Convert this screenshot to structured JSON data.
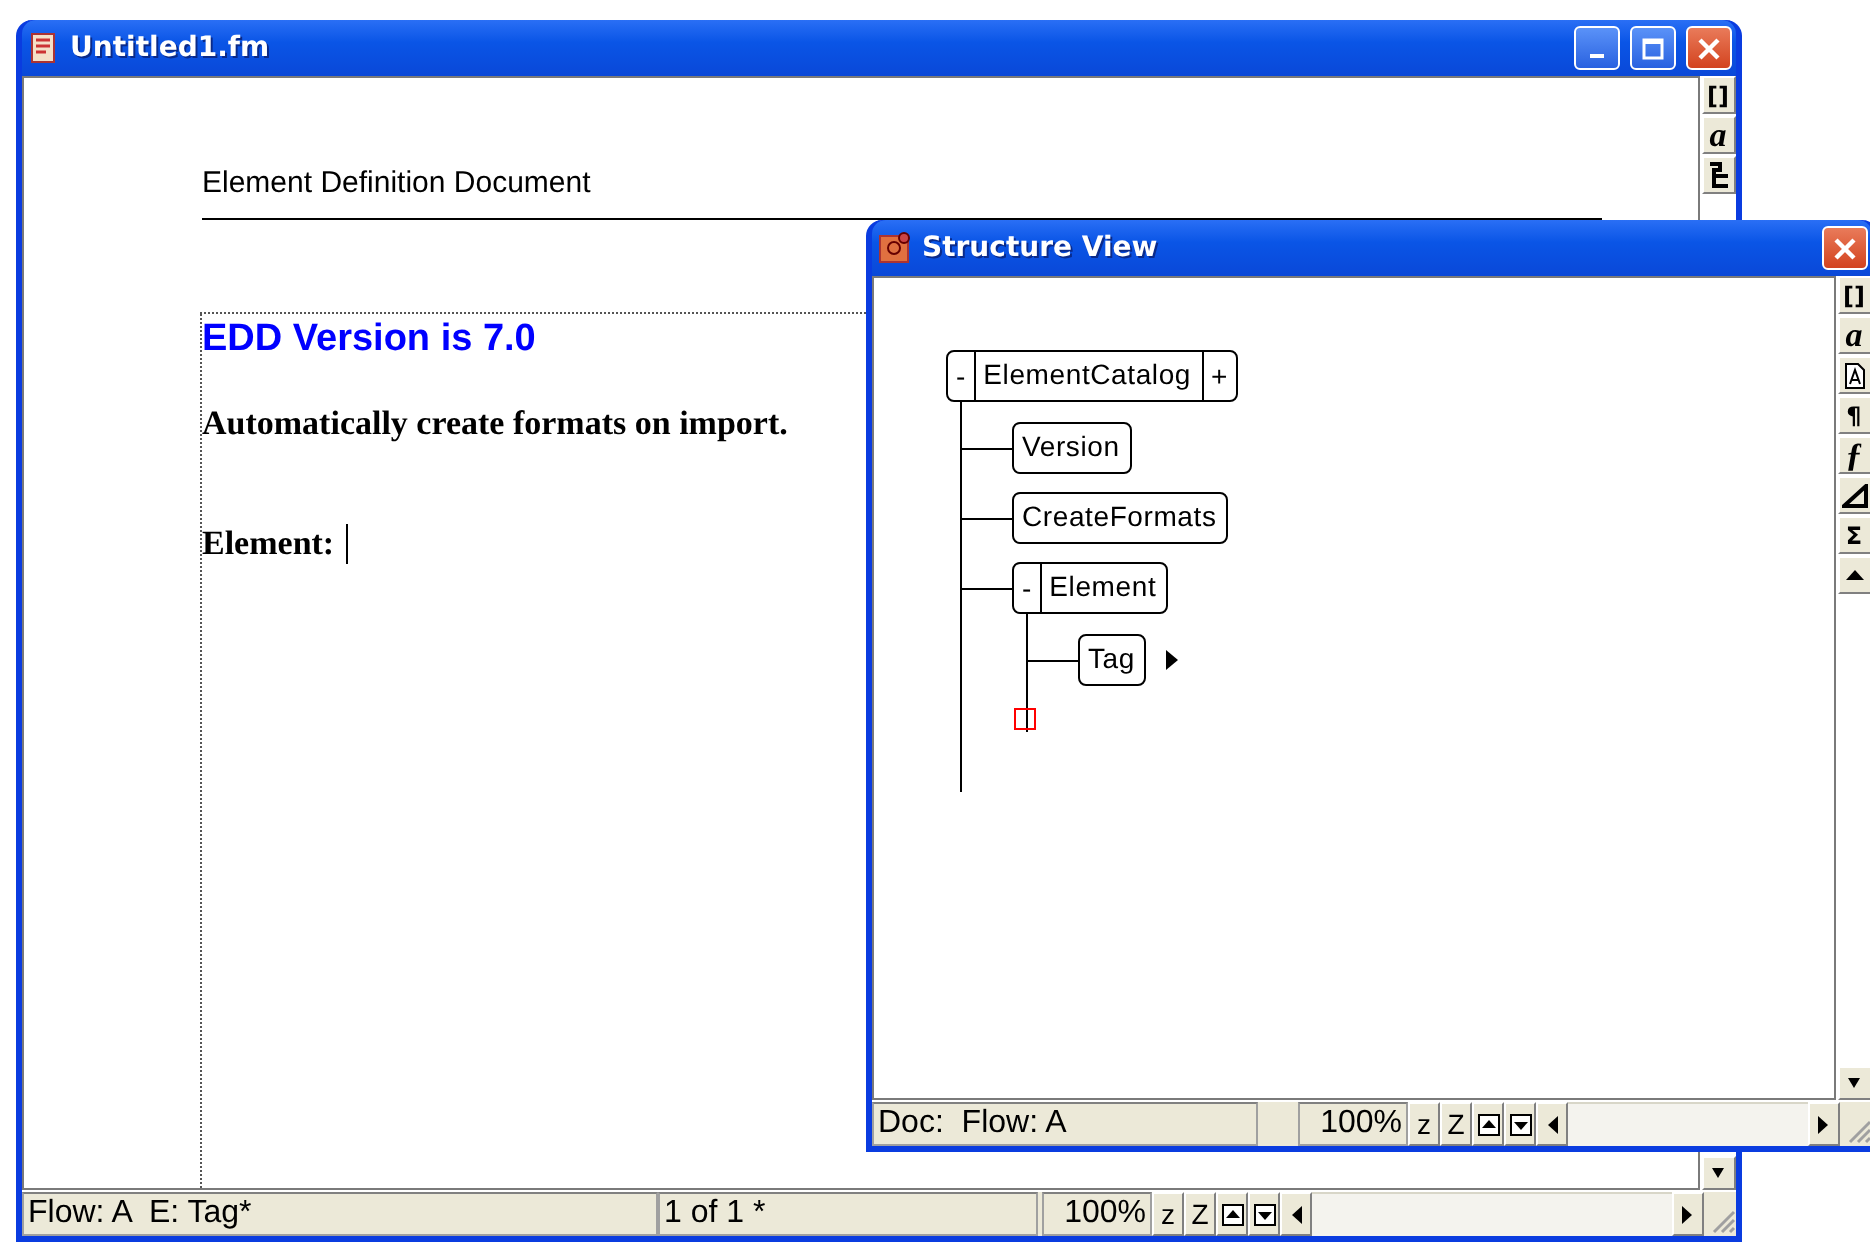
{
  "main_window": {
    "title": "Untitled1.fm",
    "document": {
      "header": "Element Definition Document",
      "paragraphs": [
        {
          "kind": "heading",
          "text": "EDD Version is 7.0"
        },
        {
          "kind": "bold",
          "text": "Automatically create formats on import."
        },
        {
          "kind": "element",
          "text": "Element:"
        }
      ]
    },
    "toolbar": [
      {
        "kind": "glyph",
        "glyph": "[]"
      },
      {
        "kind": "italic",
        "glyph": "a"
      },
      {
        "kind": "tree"
      }
    ],
    "status_bar": {
      "flow": "Flow: A  E: Tag*",
      "page": "1 of 1 *",
      "zoom": "100%",
      "zoom_out": "z",
      "zoom_in": "Z"
    }
  },
  "structure_view": {
    "title": "Structure View",
    "tree": {
      "label": "ElementCatalog",
      "toggle": "-",
      "attributes": "+",
      "children": [
        {
          "label": "Version"
        },
        {
          "label": "CreateFormats"
        },
        {
          "label": "Element",
          "toggle": "-",
          "insertion_point": true,
          "children": [
            {
              "label": "Tag",
              "insertion_arrow": true
            }
          ]
        }
      ]
    },
    "toolbar": [
      {
        "kind": "glyph",
        "glyph": "[]"
      },
      {
        "kind": "italic",
        "glyph": "a"
      },
      {
        "kind": "doc"
      },
      {
        "kind": "glyph",
        "glyph": "¶"
      },
      {
        "kind": "italic",
        "glyph": "ƒ"
      },
      {
        "kind": "triangle"
      },
      {
        "kind": "glyph",
        "glyph": "Σ"
      },
      {
        "kind": "up"
      }
    ],
    "status_bar": {
      "flow": "Doc:  Flow: A",
      "zoom": "100%",
      "zoom_out": "z",
      "zoom_in": "Z"
    }
  }
}
